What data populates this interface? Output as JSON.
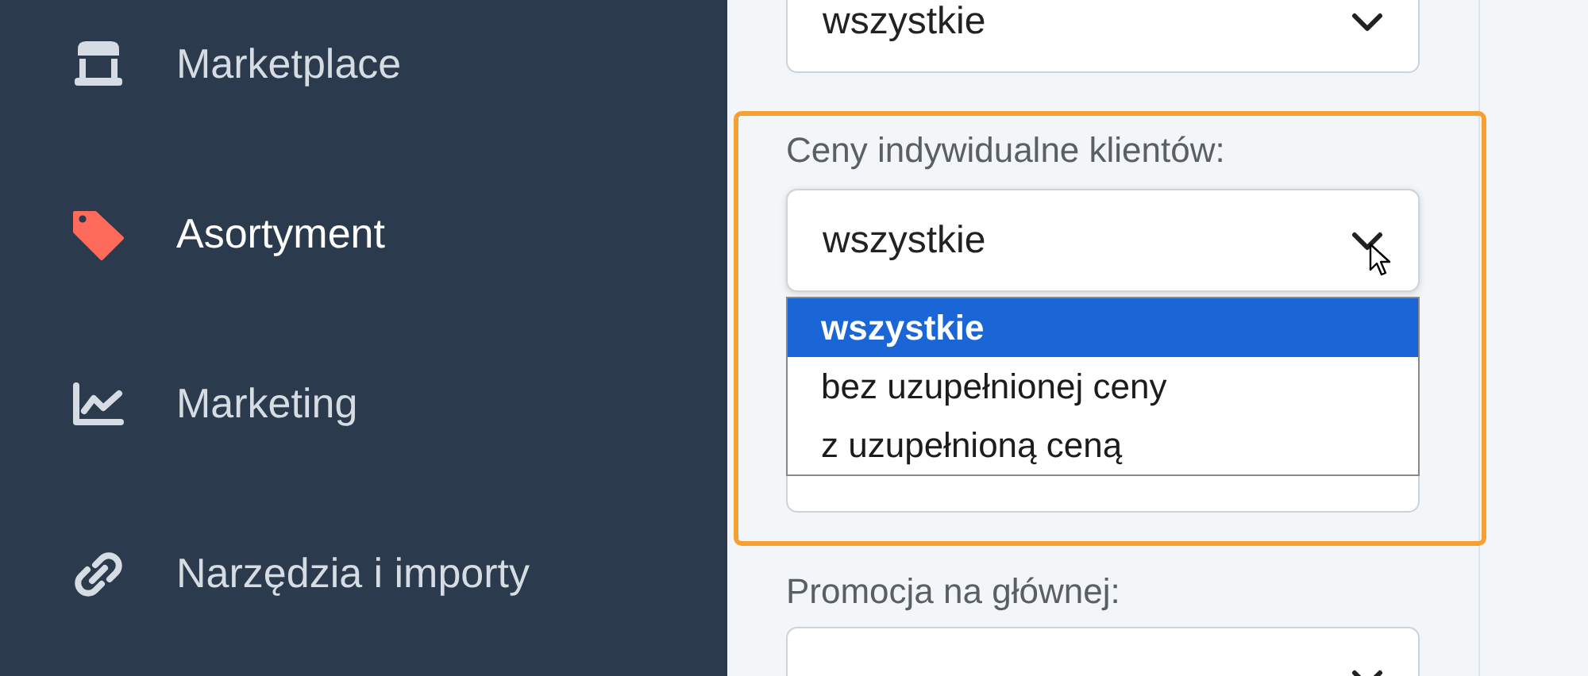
{
  "sidebar": {
    "items": [
      {
        "label": "Marketplace",
        "selected": false
      },
      {
        "label": "Asortyment",
        "selected": true
      },
      {
        "label": "Marketing",
        "selected": false
      },
      {
        "label": "Narzędzia i importy",
        "selected": false
      }
    ]
  },
  "filters": [
    {
      "value": "wszystkie",
      "highlighted": false
    },
    {
      "label": "Ceny indywidualne klientów:",
      "value": "wszystkie",
      "highlighted": true,
      "open": true,
      "secondary_field": true,
      "options": [
        {
          "label": "wszystkie",
          "selected": true
        },
        {
          "label": "bez uzupełnionej ceny",
          "selected": false
        },
        {
          "label": "z uzupełnioną ceną",
          "selected": false
        }
      ]
    },
    {
      "label": "Promocja na głównej:",
      "highlighted": false
    }
  ]
}
